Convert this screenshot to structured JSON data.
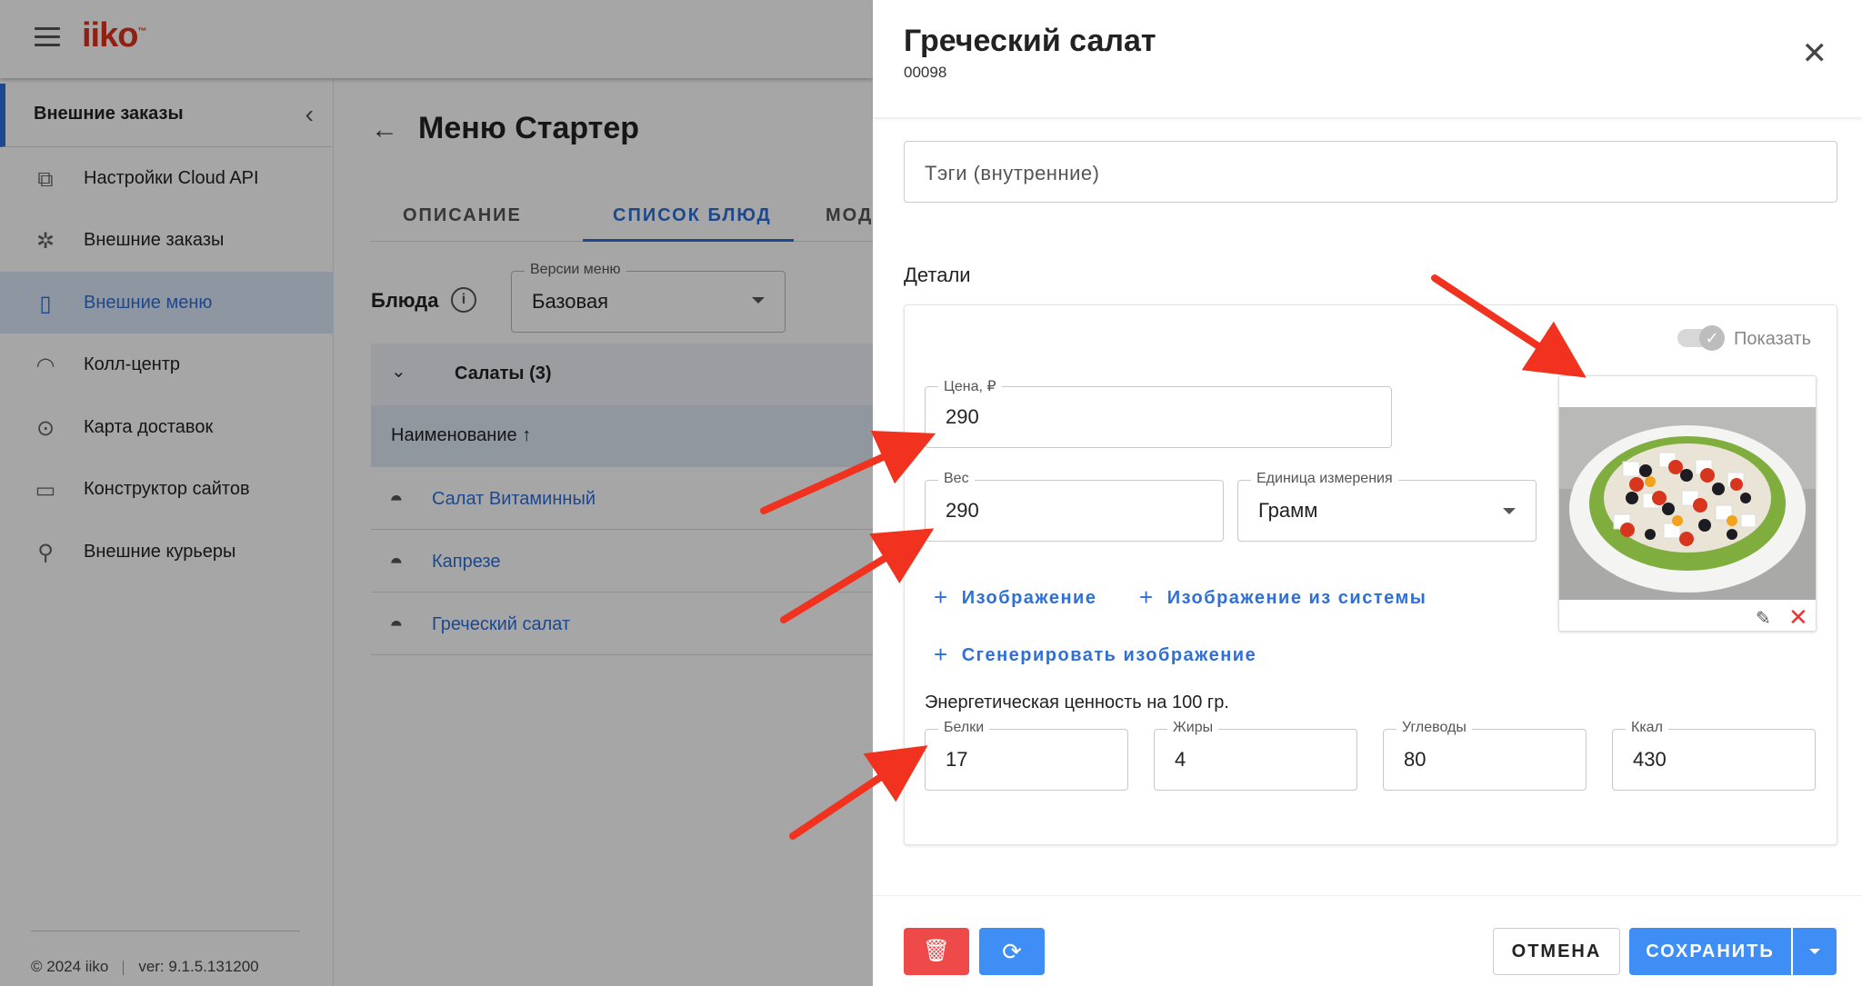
{
  "app": {
    "logo": "iiko",
    "logo_tm": "™",
    "sidebar": {
      "header": "Внешние заказы",
      "items": [
        {
          "label": "Настройки Cloud API",
          "icon": "cloud-api-icon"
        },
        {
          "label": "Внешние заказы",
          "icon": "external-orders-icon"
        },
        {
          "label": "Внешние меню",
          "icon": "external-menu-icon",
          "active": true
        },
        {
          "label": "Колл-центр",
          "icon": "headset-icon"
        },
        {
          "label": "Карта доставок",
          "icon": "map-pin-icon"
        },
        {
          "label": "Конструктор сайтов",
          "icon": "site-builder-icon"
        },
        {
          "label": "Внешние курьеры",
          "icon": "bicycle-icon"
        }
      ],
      "footer_copyright": "© 2024 iiko",
      "footer_version": "ver: 9.1.5.131200"
    },
    "main": {
      "title": "Меню Стартер",
      "tabs": [
        "ОПИСАНИЕ",
        "СПИСОК БЛЮД",
        "МОДИФИ"
      ],
      "dishes_label": "Блюда",
      "menu_version_legend": "Версии меню",
      "menu_version_value": "Базовая",
      "group_title": "Салаты (3)",
      "column_header": "Наименование ↑",
      "dishes": [
        "Салат Витаминный",
        "Капрезе",
        "Греческий салат"
      ]
    }
  },
  "drawer": {
    "title": "Греческий салат",
    "code": "00098",
    "tags_placeholder": "Тэги (внутренние)",
    "details_label": "Детали",
    "show_toggle_label": "Показать",
    "price": {
      "legend": "Цена, ₽",
      "value": "290"
    },
    "weight": {
      "legend": "Вес",
      "value": "290"
    },
    "unit": {
      "legend": "Единица измерения",
      "value": "Грамм"
    },
    "add_image": "Изображение",
    "add_system_image": "Изображение из системы",
    "generate_image": "Сгенерировать изображение",
    "energy_label": "Энергетическая ценность на 100 гр.",
    "proteins": {
      "legend": "Белки",
      "value": "17"
    },
    "fats": {
      "legend": "Жиры",
      "value": "4"
    },
    "carbs": {
      "legend": "Углеводы",
      "value": "80"
    },
    "kcal": {
      "legend": "Ккал",
      "value": "430"
    },
    "cancel_label": "ОТМЕНА",
    "save_label": "СОХРАНИТЬ"
  },
  "colors": {
    "accent": "#2f6fd8",
    "primary_button": "#3f8ef5",
    "danger": "#ef4a4a",
    "annotation_arrow": "#f0321e"
  }
}
